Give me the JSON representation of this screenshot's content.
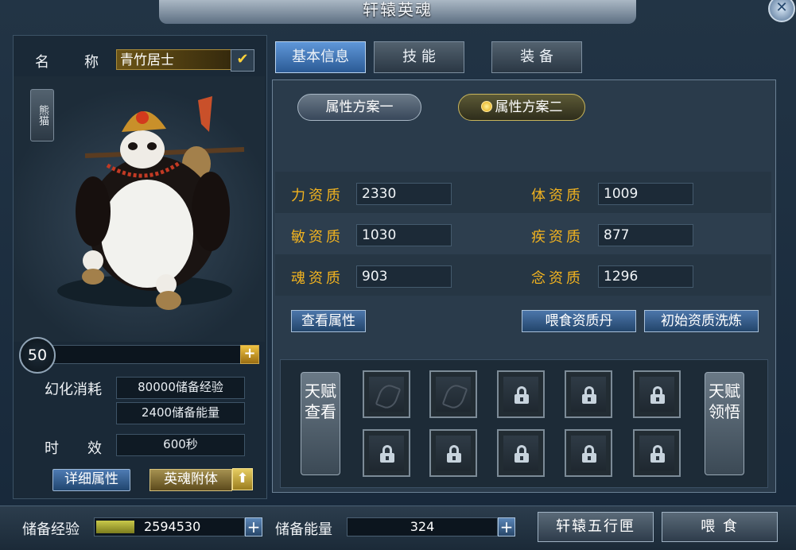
{
  "window": {
    "title": "轩辕英魂",
    "close_icon": "close-icon"
  },
  "left": {
    "name_label_1": "名",
    "name_label_2": "称",
    "name_value": "青竹居士",
    "species_tag": "熊猫",
    "level": "50",
    "level_progress_fraction": 0.02,
    "cost_label": "幻化消耗",
    "cost_exp": "80000储备经验",
    "cost_energy": "2400储备能量",
    "duration_label_1": "时",
    "duration_label_2": "效",
    "duration_value": "600秒",
    "detail_btn": "详细属性",
    "attach_btn": "英魂附体"
  },
  "tabs": [
    {
      "label": "基本信息",
      "active": true
    },
    {
      "label": "技 能",
      "active": false
    },
    {
      "label": "装 备",
      "active": false
    }
  ],
  "plans": [
    {
      "label": "属性方案一",
      "selected": false
    },
    {
      "label": "属性方案二",
      "selected": true
    }
  ],
  "attributes": [
    {
      "label": "力资质",
      "value": "2330"
    },
    {
      "label": "体资质",
      "value": "1009"
    },
    {
      "label": "敏资质",
      "value": "1030"
    },
    {
      "label": "疾资质",
      "value": "877"
    },
    {
      "label": "魂资质",
      "value": "903"
    },
    {
      "label": "念资质",
      "value": "1296"
    }
  ],
  "actions": {
    "view_attr": "查看属性",
    "feed_pill": "喂食资质丹",
    "reset": "初始资质洗炼"
  },
  "talent": {
    "view_btn": "天赋查看",
    "learn_btn": "天赋领悟"
  },
  "bottom": {
    "exp_label": "储备经验",
    "exp_value": "2594530",
    "energy_label": "储备能量",
    "energy_value": "324",
    "wuxing_btn": "轩辕五行匣",
    "feed_btn": "喂 食"
  },
  "colors": {
    "accent_blue": "#2b5a95",
    "attr_label": "#f2b31f"
  }
}
